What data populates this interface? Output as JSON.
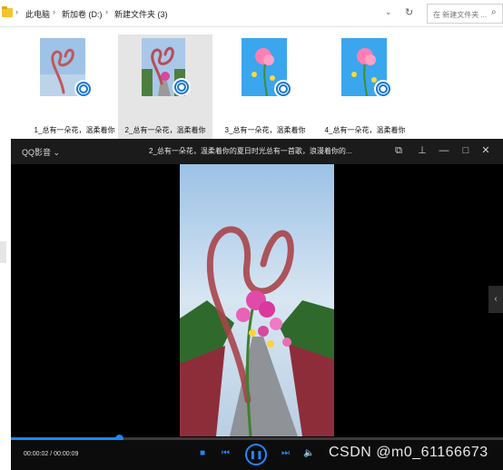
{
  "explorer": {
    "breadcrumb": [
      "此电脑",
      "新加卷 (D:)",
      "新建文件夹 (3)"
    ],
    "search_placeholder": "在 新建文件夹 ...",
    "files": [
      {
        "name": "1_总有一朵花，温柔着你",
        "thumb": "pink-grass-loop",
        "selected": false
      },
      {
        "name": "2_总有一朵花，温柔着你",
        "thumb": "pink-grass-loop",
        "selected": true
      },
      {
        "name": "3_总有一朵花，温柔着你",
        "thumb": "pink-flower-sky",
        "selected": false
      },
      {
        "name": "4_总有一朵花，温柔着你",
        "thumb": "pink-flower-sky",
        "selected": false
      }
    ]
  },
  "player": {
    "brand": "QQ影音 ⌄",
    "video_title": "2_总有一朵花，温柔着你的夏日时光总有一首歌，浪漫着你的...",
    "time_display": "00:00:02 / 00:00:09",
    "progress": 0.22,
    "watermark": "CSDN @m0_61166673",
    "icons": {
      "screenshot": "frame-icon",
      "pin": "pin-icon",
      "minimize": "minimize-icon",
      "maximize": "maximize-icon",
      "close": "close-icon",
      "stop": "stop-icon",
      "prev": "prev-icon",
      "pause": "pause-icon",
      "next": "next-icon",
      "volume": "volume-icon"
    }
  }
}
